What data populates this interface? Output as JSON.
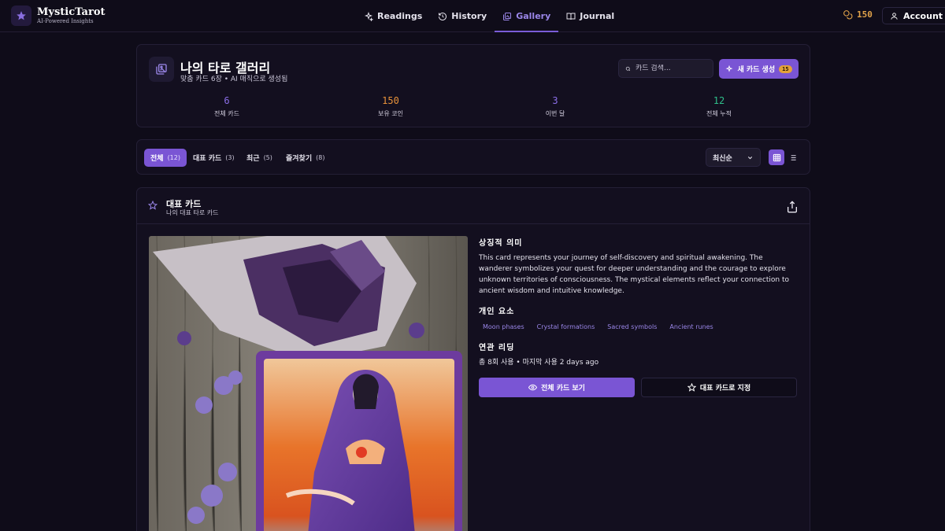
{
  "brand": {
    "name": "MysticTarot",
    "tagline": "AI-Powered Insights"
  },
  "nav": [
    {
      "label": "Readings",
      "icon": "sparkles-icon",
      "active": false
    },
    {
      "label": "History",
      "icon": "history-icon",
      "active": false
    },
    {
      "label": "Gallery",
      "icon": "gallery-icon",
      "active": true
    },
    {
      "label": "Journal",
      "icon": "book-icon",
      "active": false
    }
  ],
  "coins": "150",
  "account_label": "Account",
  "header": {
    "title": "나의 타로 갤러리",
    "subtitle": "맞춤 카드 6장 • AI 매직으로 생성됨",
    "search_placeholder": "카드 검색...",
    "create_label": "새 카드 생성",
    "create_badge": "15"
  },
  "stats": [
    {
      "value": "6",
      "label": "전체 카드",
      "color": "#8b6ee8"
    },
    {
      "value": "150",
      "label": "보유 코인",
      "color": "#e8923a"
    },
    {
      "value": "3",
      "label": "이번 달",
      "color": "#8b6ee8"
    },
    {
      "value": "12",
      "label": "전체 누적",
      "color": "#2fbf8a"
    }
  ],
  "tabs": [
    {
      "label": "전체",
      "count": "(12)",
      "active": true
    },
    {
      "label": "대표 카드",
      "count": "(3)",
      "active": false
    },
    {
      "label": "최근",
      "count": "(5)",
      "active": false
    },
    {
      "label": "즐겨찾기",
      "count": "(8)",
      "active": false
    }
  ],
  "sort_label": "최신순",
  "featured": {
    "title": "대표 카드",
    "subtitle": "나의 대표 타로 카드",
    "meaning_heading": "상징적 의미",
    "meaning_text": "This card represents your journey of self-discovery and spiritual awakening. The wanderer symbolizes your quest for deeper understanding and the courage to explore unknown territories of consciousness. The mystical elements reflect your connection to ancient wisdom and intuitive knowledge.",
    "elements_heading": "개인 요소",
    "elements": [
      "Moon phases",
      "Crystal formations",
      "Sacred symbols",
      "Ancient runes"
    ],
    "readings_heading": "연관 리딩",
    "readings_text": "총 8회 사용 • 마지막 사용 2 days ago",
    "view_button": "전체 카드 보기",
    "set_featured_button": "대표 카드로 지정"
  }
}
